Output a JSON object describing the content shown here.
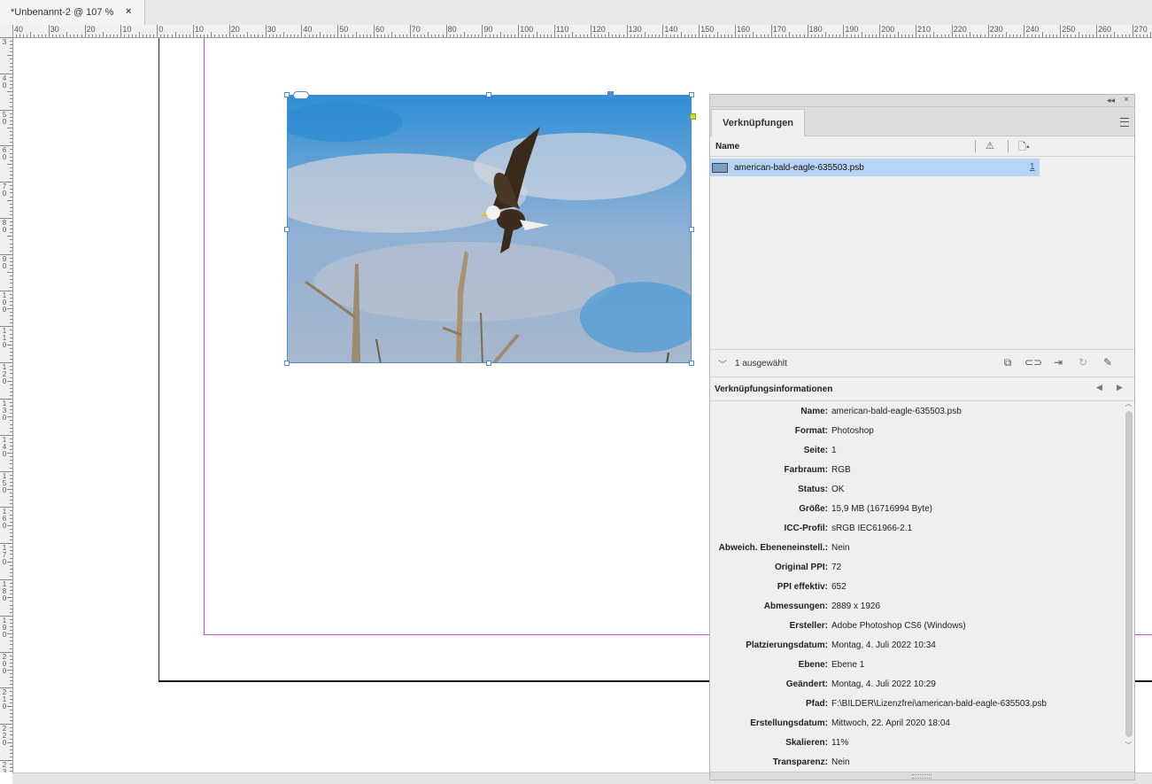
{
  "document_tab": {
    "title": "*Unbenannt-2 @ 107 %",
    "close": "×"
  },
  "ruler_top": {
    "labels": [
      "40",
      "30",
      "20",
      "10",
      "0",
      "10",
      "20",
      "30",
      "40",
      "50",
      "60",
      "70",
      "80",
      "90",
      "100",
      "110",
      "120",
      "130",
      "140",
      "150",
      "160",
      "170",
      "180",
      "190",
      "200",
      "210",
      "220",
      "230",
      "240",
      "250",
      "260",
      "270"
    ]
  },
  "ruler_left": {
    "labels": [
      "3",
      "4 0",
      "5 0",
      "6 0",
      "7 0",
      "8 0",
      "9 0",
      "1 0 0",
      "1 1 0",
      "1 2 0",
      "1 3 0",
      "1 4 0",
      "1 5 0",
      "1 6 0",
      "1 7 0",
      "1 8 0",
      "1 9 0",
      "2 0 0",
      "2 1 0",
      "2 2 0",
      "2 3 0"
    ]
  },
  "panel": {
    "tab_label": "Verknüpfungen",
    "collapse_icon": "◂◂",
    "close_icon": "×",
    "column_name": "Name",
    "column_warning_icon": "⚠",
    "column_page_icon": "🗋▴",
    "links": [
      {
        "name": "american-bald-eagle-635503.psb",
        "page": "1",
        "selected": true
      }
    ],
    "selection_status": "1 ausgewählt",
    "tools": [
      "relink-from-cc-icon",
      "goto-link-icon",
      "relink-icon",
      "update-link-icon",
      "edit-original-icon"
    ],
    "info_title": "Verknüpfungsinformationen",
    "info": [
      {
        "label": "Name:",
        "value": "american-bald-eagle-635503.psb"
      },
      {
        "label": "Format:",
        "value": "Photoshop"
      },
      {
        "label": "Seite:",
        "value": "1"
      },
      {
        "label": "Farbraum:",
        "value": "RGB"
      },
      {
        "label": "Status:",
        "value": "OK"
      },
      {
        "label": "Größe:",
        "value": "15,9 MB (16716994 Byte)"
      },
      {
        "label": "ICC-Profil:",
        "value": "sRGB IEC61966-2.1"
      },
      {
        "label": "Abweich. Ebeneneinstell.:",
        "value": "Nein"
      },
      {
        "label": "Original PPI:",
        "value": "72"
      },
      {
        "label": "PPI effektiv:",
        "value": "652"
      },
      {
        "label": "Abmessungen:",
        "value": "2889 x 1926"
      },
      {
        "label": "Ersteller:",
        "value": "Adobe Photoshop CS6 (Windows)"
      },
      {
        "label": "Platzierungsdatum:",
        "value": "Montag, 4. Juli 2022 10:34"
      },
      {
        "label": "Ebene:",
        "value": "Ebene 1"
      },
      {
        "label": "Geändert:",
        "value": "Montag, 4. Juli 2022 10:29"
      },
      {
        "label": "Pfad:",
        "value": "F:\\BILDER\\Lizenzfrei\\american-bald-eagle-635503.psb"
      },
      {
        "label": "Erstellungsdatum:",
        "value": "Mittwoch, 22. April 2020 18:04"
      },
      {
        "label": "Skalieren:",
        "value": "11%"
      },
      {
        "label": "Transparenz:",
        "value": "Nein"
      }
    ]
  },
  "colors": {
    "selection_row": "#b8d3f3",
    "frame_border": "#4a8cd8",
    "margin_guide": "#c44ed0"
  }
}
